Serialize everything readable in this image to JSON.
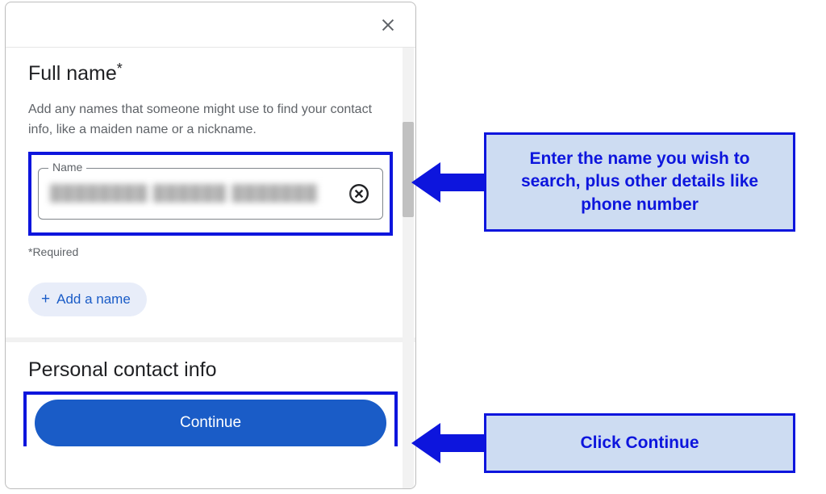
{
  "dialog": {
    "fullNameTitle": "Full name",
    "asterisk": "*",
    "description": "Add any names that someone might use to find your contact info, like a maiden name or a nickname.",
    "nameFieldLabel": "Name",
    "nameFieldValue": "████████ ██████ ███████",
    "requiredNote": "*Required",
    "addNameLabel": "Add a name",
    "contactInfoTitle": "Personal contact info",
    "continueLabel": "Continue"
  },
  "callouts": {
    "inputInstruction": "Enter the name you wish to search, plus other details like phone number",
    "continueInstruction": "Click Continue"
  }
}
